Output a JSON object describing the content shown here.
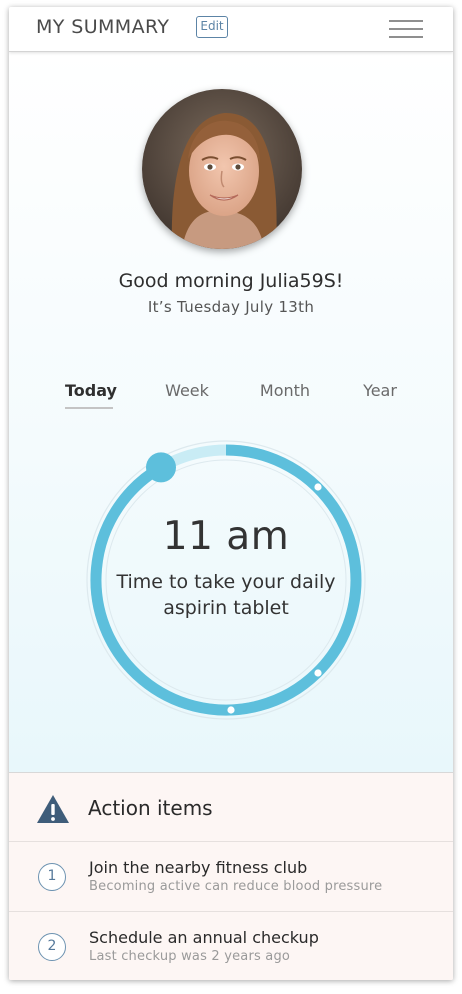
{
  "header": {
    "title": "MY SUMMARY",
    "edit_label": "Edit",
    "menu_icon": "hamburger-menu-icon"
  },
  "profile": {
    "avatar": "profile-photo",
    "greeting": "Good morning Julia59S!",
    "date": "It’s Tuesday July 13th"
  },
  "tabs": [
    {
      "label": "Today",
      "active": true
    },
    {
      "label": "Week",
      "active": false
    },
    {
      "label": "Month",
      "active": false
    },
    {
      "label": "Year",
      "active": false
    }
  ],
  "reminder": {
    "time": "11 am",
    "message": "Time to take your daily aspirin tablet"
  },
  "actions": {
    "title": "Action items",
    "icon": "warning-triangle-icon",
    "items": [
      {
        "number": "1",
        "title": "Join the nearby fitness club",
        "subtitle": "Becoming active can reduce blood pressure"
      },
      {
        "number": "2",
        "title": "Schedule an annual checkup",
        "subtitle": "Last checkup was 2 years ago"
      }
    ]
  },
  "colors": {
    "accent": "#5dbfdc",
    "accent_light": "#c9ecf5",
    "link_blue": "#5c84a6",
    "warning_icon": "#3f5d7a",
    "actions_background": "#fdf6f4"
  }
}
